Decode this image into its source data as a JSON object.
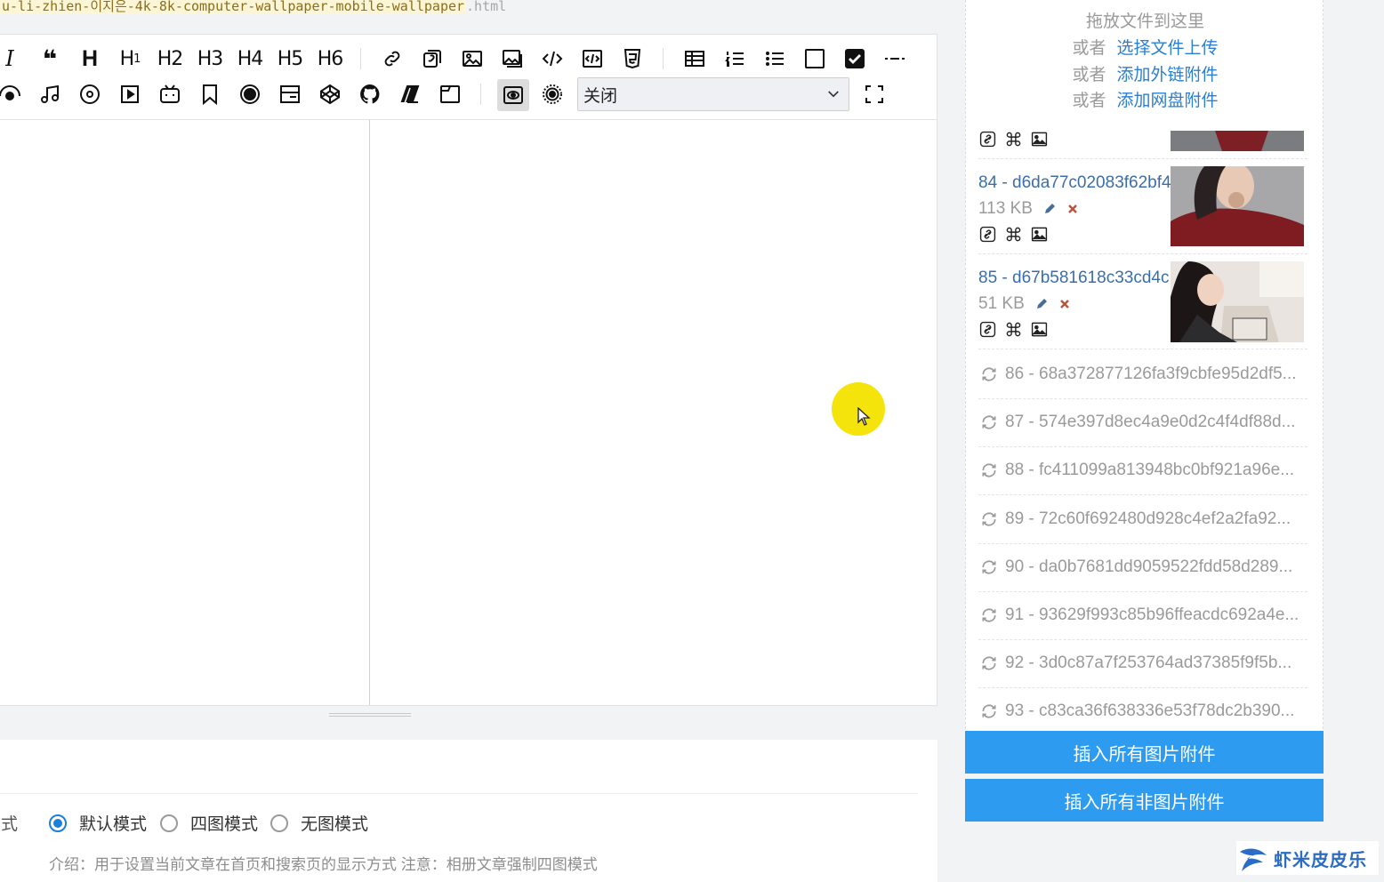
{
  "slug": {
    "main": "u-li-zhien-이지은-4k-8k-computer-wallpaper-mobile-wallpaper",
    "ext": ".html"
  },
  "toolbar": {
    "h1": "H",
    "h1_sub": "1",
    "h2": "H",
    "h2_sub": "2",
    "h3": "H",
    "h3_sub": "3",
    "h4": "H",
    "h4_sub": "4",
    "h5": "H",
    "h5_sub": "5",
    "h6": "H",
    "h6_sub": "6",
    "heading": "H",
    "italic": "I",
    "quote": "❝",
    "select_value": "关闭",
    "icons_row1": [
      "italic-icon",
      "quote-icon",
      "heading-icon",
      "h1-icon",
      "h2-icon",
      "h3-icon",
      "h4-icon",
      "h5-icon",
      "h6-icon",
      "link-icon",
      "reference-icon",
      "image-icon",
      "image-gallery-icon",
      "code-icon",
      "code-block-icon",
      "html5-icon",
      "table-icon",
      "ordered-list-icon",
      "unordered-list-icon",
      "checkbox-empty-icon",
      "checkbox-checked-icon",
      "horizontal-rule-icon"
    ],
    "icons_row2": [
      "eye-icon",
      "music-icon",
      "disc-icon",
      "video-icon",
      "bilibili-icon",
      "bookmark-icon",
      "record-icon",
      "card-icon",
      "codepen-icon",
      "github-icon",
      "book-icon",
      "window-icon",
      "preview-icon",
      "target-icon",
      "fullscreen-icon"
    ]
  },
  "settings": {
    "label": "方式",
    "options": [
      {
        "label": "默认模式",
        "checked": true
      },
      {
        "label": "四图模式",
        "checked": false
      },
      {
        "label": "无图模式",
        "checked": false
      }
    ],
    "intro": "介绍：用于设置当前文章在首页和搜索页的显示方式 注意：相册文章强制四图模式"
  },
  "panel": {
    "drop_title": "拖放文件到这里",
    "or": "或者",
    "upload_link": "选择文件上传",
    "external_link": "添加外链附件",
    "netdisk_link": "添加网盘附件",
    "attachments": [
      {
        "name": "84 - d6da77c02083f62bf4",
        "size": "113 KB"
      },
      {
        "name": "85 - d67b581618c33cd4c",
        "size": "51 KB"
      }
    ],
    "pending": [
      "86 - 68a372877126fa3f9cbfe95d2df5...",
      "87 - 574e397d8ec4a9e0d2c4f4df88d...",
      "88 - fc411099a813948bc0bf921a96e...",
      "89 - 72c60f692480d928c4ef2a2fa92...",
      "90 - da0b7681dd9059522fdd58d289...",
      "91 - 93629f993c85b96ffeacdc692a4e...",
      "92 - 3d0c87a7f253764ad37385f9f5b...",
      "93 - c83ca36f638336e53f78dc2b390..."
    ],
    "insert_images": "插入所有图片附件",
    "insert_non_images": "插入所有非图片附件"
  },
  "watermark": "虾米皮皮乐"
}
